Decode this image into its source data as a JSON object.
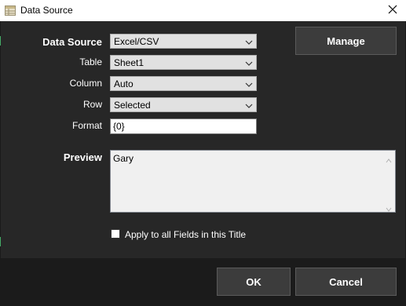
{
  "window": {
    "title": "Data Source",
    "close_icon": "close-icon",
    "app_icon": "data-source-icon"
  },
  "form": {
    "data_source": {
      "label": "Data Source",
      "value": "Excel/CSV"
    },
    "table": {
      "label": "Table",
      "value": "Sheet1"
    },
    "column": {
      "label": "Column",
      "value": "Auto"
    },
    "row": {
      "label": "Row",
      "value": "Selected"
    },
    "format": {
      "label": "Format",
      "value": "{0}"
    },
    "preview": {
      "label": "Preview",
      "value": "Gary"
    }
  },
  "buttons": {
    "manage": "Manage",
    "ok": "OK",
    "cancel": "Cancel"
  },
  "apply_all": {
    "label": "Apply to all Fields in this Title",
    "checked": false
  },
  "colors": {
    "background": "#272727",
    "footer": "#1b1b1b",
    "button": "#3c3c3c"
  }
}
